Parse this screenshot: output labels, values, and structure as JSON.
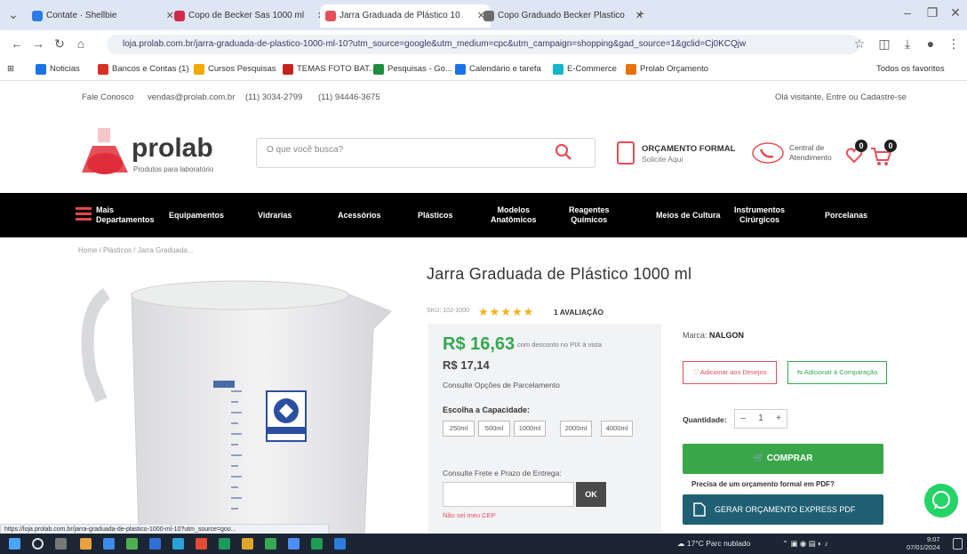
{
  "browser": {
    "tabs": [
      {
        "label": "Contate · Shellbie",
        "color": "#2a7be4"
      },
      {
        "label": "Copo de Becker Sas 1000 ml",
        "color": "#d22a4d"
      },
      {
        "label": "Jarra Graduada de Plástico 10",
        "color": "#e54f58"
      },
      {
        "label": "Copo Graduado Becker Plastico",
        "color": "#6b6b6b"
      }
    ],
    "new_tab": "+",
    "url": "loja.prolab.com.br/jarra-graduada-de-plastico-1000-ml-10?utm_source=google&utm_medium=cpc&utm_campaign=shopping&gad_source=1&gclid=Cj0KCQjw",
    "bookmarks": [
      {
        "label": "Noticias",
        "color": "#1a73e8"
      },
      {
        "label": "Bancos e Contas (1)",
        "color": "#d93025"
      },
      {
        "label": "Cursos Pesquisas",
        "color": "#f2a900"
      },
      {
        "label": "TEMAS FOTO BAT...",
        "color": "#c5221f"
      },
      {
        "label": "Pesquisas - Go...",
        "color": "#1e8e3e"
      },
      {
        "label": "Calendário e tarefa",
        "color": "#1a73e8"
      },
      {
        "label": "E-Commerce",
        "color": "#12b5cb"
      },
      {
        "label": "Prolab Orçamento",
        "color": "#e8710a"
      }
    ],
    "all_bookmarks": "Todos os favoritos"
  },
  "toplinks": {
    "whatsapp": "Fale Conosco",
    "email": "vendas@prolab.com.br",
    "phone1": "(11) 3034-2799",
    "phone2": "(11) 94446-3675",
    "welcome": "Olá visitante, Entre ou Cadastre-se"
  },
  "header": {
    "logo": "prolab",
    "logo_sub": "Produtos para laboratório",
    "search_placeholder": "O que você busca?",
    "quote_title": "ORÇAMENTO FORMAL",
    "quote_sub": "Solicite Aqui",
    "call_line1": "Central de",
    "call_line2": "Atendimento",
    "wishlist_count": "0",
    "cart_count": "0"
  },
  "nav": {
    "departments": [
      "Mais",
      "Departamentos"
    ],
    "items": [
      [
        "Equipamentos"
      ],
      [
        "Vidrarias"
      ],
      [
        "Acessórios"
      ],
      [
        "Plásticos"
      ],
      [
        "Modelos",
        "Anatômicos"
      ],
      [
        "Reagentes",
        "Químicos"
      ],
      [
        "Meios de Cultura"
      ],
      [
        "Instrumentos",
        "Cirúrgicos"
      ],
      [
        "Porcelanas"
      ]
    ]
  },
  "breadcrumb": "Home / Plásticos / Jarra Graduada...",
  "product": {
    "title": "Jarra Graduada de Plástico 1000 ml",
    "sku": "SKU: 102-1000",
    "stars": "★★★★★",
    "reviews": "1 AVALIAÇÃO",
    "price": "R$ 16,63",
    "price_note": "com desconto no PIX à vista",
    "price_regular": "R$ 17,14",
    "installments": "Consulte Opções de Parcelamento",
    "capacity_label": "Escolha a Capacidade:",
    "capacities": [
      "250ml",
      "500ml",
      "1000ml",
      "2000ml",
      "4000ml"
    ],
    "shipping_label": "Consulte Frete e Prazo de Entrega:",
    "ok": "OK",
    "cep_link": "Não sei meu CEP",
    "brand_label": "Marca:",
    "brand": "NALGON",
    "wishlist_btn": "Adicionar aos Desejos",
    "compare_btn": "Adicionar à Comparação",
    "qty_label": "Quantidade:",
    "qty": "1",
    "buy_btn": "COMPRAR",
    "formal_note": "Precisa de um orçamento formal em PDF?",
    "pdf_btn": "GERAR ORÇAMENTO EXPRESS PDF"
  },
  "status_url": "https://loja.prolab.com.br/jarra-graduada-de-plastico-1000-ml-10?utm_source=goo...",
  "taskbar": {
    "weather": "17°C Parc nublado",
    "time": "9:07",
    "date": "07/01/2024"
  },
  "colors": {
    "accent_red": "#e54f58",
    "price_green": "#33a850",
    "buy_green": "#3aa64a",
    "pdf_teal": "#1f5f73",
    "nav_black": "#000000"
  }
}
